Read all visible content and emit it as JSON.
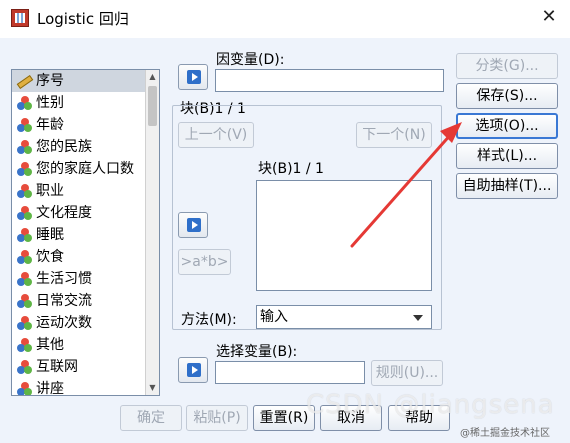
{
  "window": {
    "title": "Logistic 回归",
    "close_glyph": "✕"
  },
  "variables": [
    {
      "label": "序号",
      "icon": "pencil-icon"
    },
    {
      "label": "性别",
      "icon": "nominal-icon"
    },
    {
      "label": "年龄",
      "icon": "nominal-icon"
    },
    {
      "label": "您的民族",
      "icon": "nominal-icon"
    },
    {
      "label": "您的家庭人口数",
      "icon": "nominal-icon"
    },
    {
      "label": "职业",
      "icon": "nominal-icon"
    },
    {
      "label": "文化程度",
      "icon": "nominal-icon"
    },
    {
      "label": "睡眠",
      "icon": "nominal-icon"
    },
    {
      "label": "饮食",
      "icon": "nominal-icon"
    },
    {
      "label": "生活习惯",
      "icon": "nominal-icon"
    },
    {
      "label": "日常交流",
      "icon": "nominal-icon"
    },
    {
      "label": "运动次数",
      "icon": "nominal-icon"
    },
    {
      "label": "其他",
      "icon": "nominal-icon"
    },
    {
      "label": "互联网",
      "icon": "nominal-icon"
    },
    {
      "label": "讲座",
      "icon": "nominal-icon"
    }
  ],
  "dependent": {
    "label": "因变量(D):",
    "value": ""
  },
  "block": {
    "header": "块(B)1 / 1",
    "inner_label": "块(B)1 / 1",
    "prev_label": "上一个(V)",
    "next_label": "下一个(N)",
    "interaction_label": ">a*b>"
  },
  "method": {
    "label": "方法(M):",
    "value": "输入"
  },
  "selection": {
    "label": "选择变量(B):",
    "value": "",
    "rule_label": "规则(U)..."
  },
  "side_buttons": {
    "categorical": "分类(G)...",
    "save": "保存(S)...",
    "options": "选项(O)...",
    "style": "样式(L)...",
    "bootstrap": "自助抽样(T)..."
  },
  "bottom_buttons": {
    "ok": "确定",
    "paste": "粘贴(P)",
    "reset": "重置(R)",
    "cancel": "取消",
    "help": "帮助"
  },
  "watermark": {
    "text": "CSDN @liangsena",
    "small": "@稀土掘金技术社区"
  },
  "colors": {
    "annotation_arrow": "#e53935",
    "focus": "#3a78d4"
  }
}
